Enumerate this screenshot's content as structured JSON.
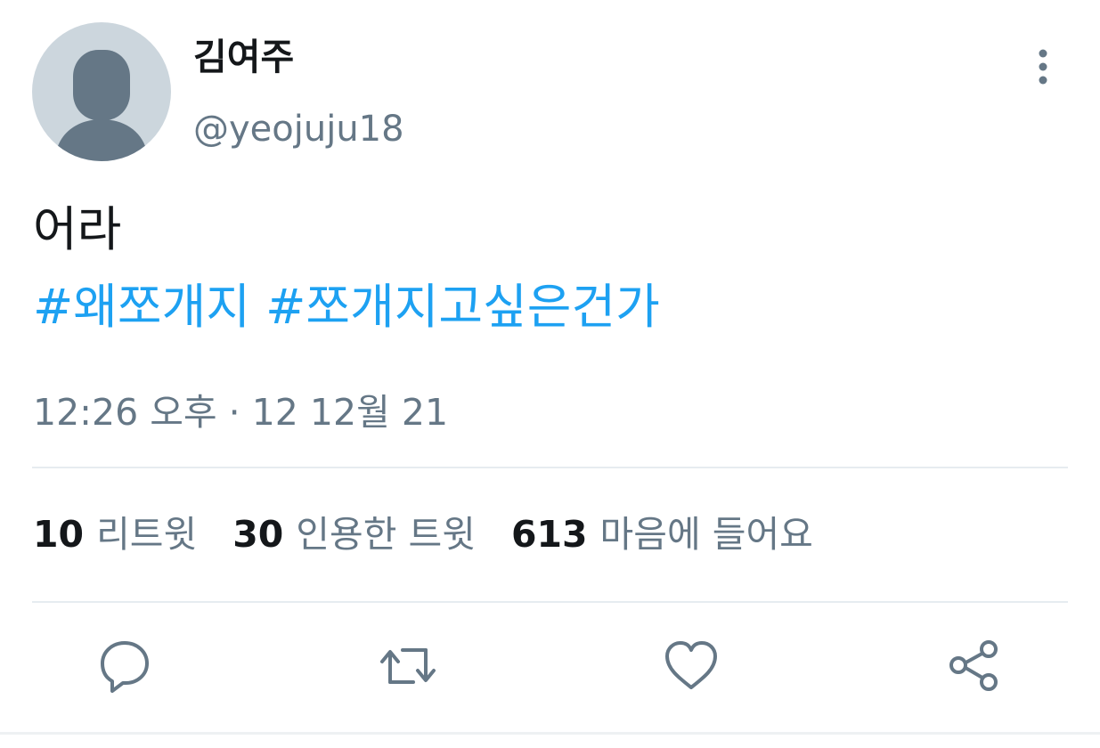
{
  "user": {
    "display_name": "김여주",
    "handle": "@yeojuju18"
  },
  "tweet": {
    "text": "어라",
    "hashtags": [
      "#왜쪼개지",
      "#쪼개지고싶은건가"
    ],
    "timestamp": "12:26 오후 · 12 12월 21"
  },
  "stats": {
    "retweets": {
      "count": "10",
      "label": "리트윗"
    },
    "quotes": {
      "count": "30",
      "label": "인용한 트윗"
    },
    "likes": {
      "count": "613",
      "label": "마음에 들어요"
    }
  },
  "actions": [
    "reply-icon",
    "retweet-icon",
    "heart-icon",
    "share-icon"
  ],
  "colors": {
    "link": "#1da1f2",
    "secondary_text": "#657786",
    "primary_text": "#14171a",
    "avatar_bg": "#ccd6dd",
    "avatar_figure": "#657786",
    "divider": "#e6ecf0"
  }
}
